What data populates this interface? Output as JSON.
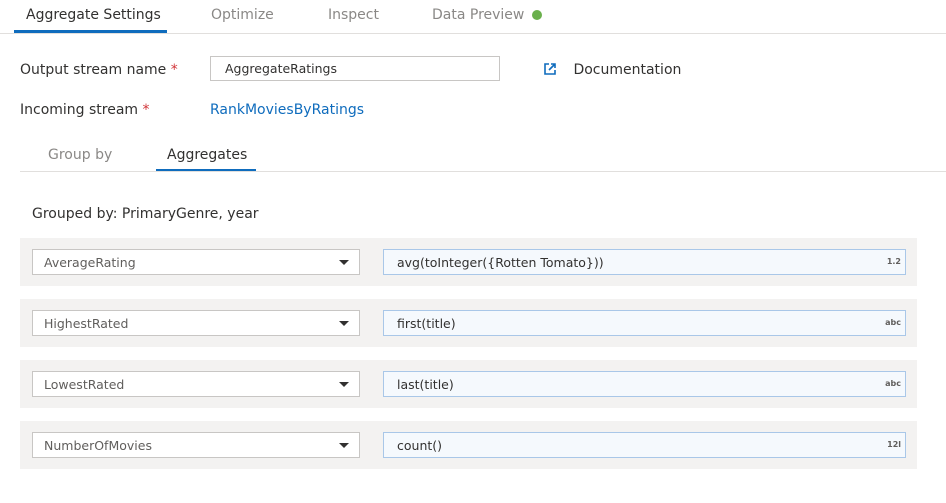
{
  "tabs": [
    {
      "label": "Aggregate Settings"
    },
    {
      "label": "Optimize"
    },
    {
      "label": "Inspect"
    },
    {
      "label": "Data Preview"
    }
  ],
  "status_dot_color": "#6ab04c",
  "output_stream": {
    "label": "Output stream name",
    "required": "*",
    "value": "AggregateRatings"
  },
  "documentation": {
    "label": "Documentation",
    "icon": "external-link-icon"
  },
  "incoming_stream": {
    "label": "Incoming stream",
    "required": "*",
    "value": "RankMoviesByRatings"
  },
  "subtabs": [
    {
      "label": "Group by"
    },
    {
      "label": "Aggregates"
    }
  ],
  "grouped_by": "Grouped by: PrimaryGenre, year",
  "aggregates": [
    {
      "column": "AverageRating",
      "expression": "avg(toInteger({Rotten Tomato}))",
      "type": "1.2"
    },
    {
      "column": "HighestRated",
      "expression": "first(title)",
      "type": "abc"
    },
    {
      "column": "LowestRated",
      "expression": "last(title)",
      "type": "abc"
    },
    {
      "column": "NumberOfMovies",
      "expression": "count()",
      "type": "12l"
    }
  ]
}
